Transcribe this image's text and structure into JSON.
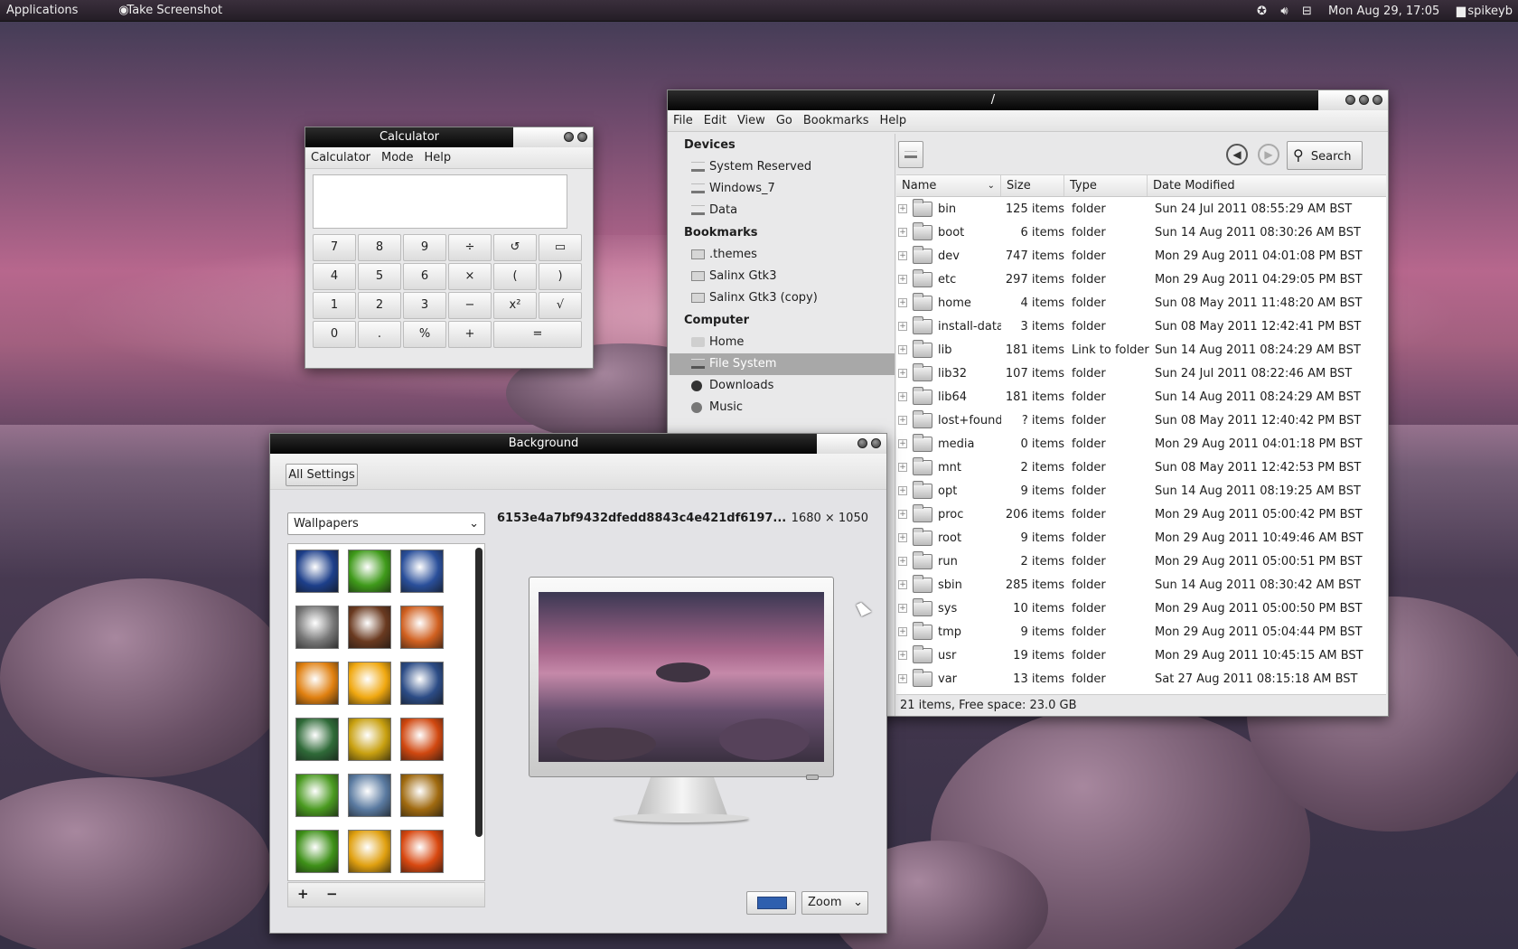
{
  "panel": {
    "applications": "Applications",
    "screenshot_app": "Take Screenshot",
    "clock": "Mon Aug 29, 17:05",
    "user": "spikeyb"
  },
  "calculator": {
    "title": "Calculator",
    "menu": [
      "Calculator",
      "Mode",
      "Help"
    ],
    "keys": [
      "7",
      "8",
      "9",
      "÷",
      "4",
      "5",
      "6",
      "×",
      "(",
      ")",
      "1",
      "2",
      "3",
      "−",
      "x²",
      "√",
      "0",
      ".",
      "%",
      "+",
      "="
    ]
  },
  "files": {
    "title": "/",
    "menu": [
      "File",
      "Edit",
      "View",
      "Go",
      "Bookmarks",
      "Help"
    ],
    "sidebar": {
      "devices_header": "Devices",
      "devices": [
        "System Reserved",
        "Windows_7",
        "Data"
      ],
      "bookmarks_header": "Bookmarks",
      "bookmarks": [
        ".themes",
        "Salinx Gtk3",
        "Salinx Gtk3 (copy)"
      ],
      "computer_header": "Computer",
      "computer": [
        "Home",
        "File System",
        "Downloads",
        "Music"
      ]
    },
    "search_label": "Search",
    "columns": [
      "Name",
      "Size",
      "Type",
      "Date Modified"
    ],
    "rows": [
      {
        "name": "bin",
        "size": "125 items",
        "type": "folder",
        "date": "Sun 24 Jul 2011 08:55:29 AM BST"
      },
      {
        "name": "boot",
        "size": "6 items",
        "type": "folder",
        "date": "Sun 14 Aug 2011 08:30:26 AM BST"
      },
      {
        "name": "dev",
        "size": "747 items",
        "type": "folder",
        "date": "Mon 29 Aug 2011 04:01:08 PM BST"
      },
      {
        "name": "etc",
        "size": "297 items",
        "type": "folder",
        "date": "Mon 29 Aug 2011 04:29:05 PM BST"
      },
      {
        "name": "home",
        "size": "4 items",
        "type": "folder",
        "date": "Sun 08 May 2011 11:48:20 AM BST"
      },
      {
        "name": "install-data",
        "size": "3 items",
        "type": "folder",
        "date": "Sun 08 May 2011 12:42:41 PM BST"
      },
      {
        "name": "lib",
        "size": "181 items",
        "type": "Link to folder",
        "date": "Sun 14 Aug 2011 08:24:29 AM BST"
      },
      {
        "name": "lib32",
        "size": "107 items",
        "type": "folder",
        "date": "Sun 24 Jul 2011 08:22:46 AM BST"
      },
      {
        "name": "lib64",
        "size": "181 items",
        "type": "folder",
        "date": "Sun 14 Aug 2011 08:24:29 AM BST"
      },
      {
        "name": "lost+found",
        "size": "? items",
        "type": "folder",
        "date": "Sun 08 May 2011 12:40:42 PM BST"
      },
      {
        "name": "media",
        "size": "0 items",
        "type": "folder",
        "date": "Mon 29 Aug 2011 04:01:18 PM BST"
      },
      {
        "name": "mnt",
        "size": "2 items",
        "type": "folder",
        "date": "Sun 08 May 2011 12:42:53 PM BST"
      },
      {
        "name": "opt",
        "size": "9 items",
        "type": "folder",
        "date": "Sun 14 Aug 2011 08:19:25 AM BST"
      },
      {
        "name": "proc",
        "size": "206 items",
        "type": "folder",
        "date": "Mon 29 Aug 2011 05:00:42 PM BST"
      },
      {
        "name": "root",
        "size": "9 items",
        "type": "folder",
        "date": "Mon 29 Aug 2011 10:49:46 AM BST"
      },
      {
        "name": "run",
        "size": "2 items",
        "type": "folder",
        "date": "Mon 29 Aug 2011 05:00:51 PM BST"
      },
      {
        "name": "sbin",
        "size": "285 items",
        "type": "folder",
        "date": "Sun 14 Aug 2011 08:30:42 AM BST"
      },
      {
        "name": "sys",
        "size": "10 items",
        "type": "folder",
        "date": "Mon 29 Aug 2011 05:00:50 PM BST"
      },
      {
        "name": "tmp",
        "size": "9 items",
        "type": "folder",
        "date": "Mon 29 Aug 2011 05:04:44 PM BST"
      },
      {
        "name": "usr",
        "size": "19 items",
        "type": "folder",
        "date": "Mon 29 Aug 2011 10:45:15 AM BST"
      },
      {
        "name": "var",
        "size": "13 items",
        "type": "folder",
        "date": "Sat 27 Aug 2011 08:15:18 AM BST"
      }
    ],
    "status": "21 items, Free space: 23.0 GB"
  },
  "background": {
    "title": "Background",
    "all_settings": "All Settings",
    "source": "Wallpapers",
    "filename": "6153e4a7bf9432dfedd8843c4e421df6197...",
    "resolution": "1680 × 1050",
    "add": "+",
    "remove": "−",
    "zoom": "Zoom",
    "color": "#2f5fae",
    "thumb_colors": [
      "#1d3f8a",
      "#3f9a1a",
      "#2a4f9a",
      "#777777",
      "#6a3a20",
      "#d06020",
      "#e08010",
      "#f0a810",
      "#2c4c86",
      "#2f6a38",
      "#c8a010",
      "#d04810",
      "#4a9a20",
      "#5a7aa0",
      "#a06a10",
      "#3e9018",
      "#e0a010",
      "#d84810"
    ]
  }
}
